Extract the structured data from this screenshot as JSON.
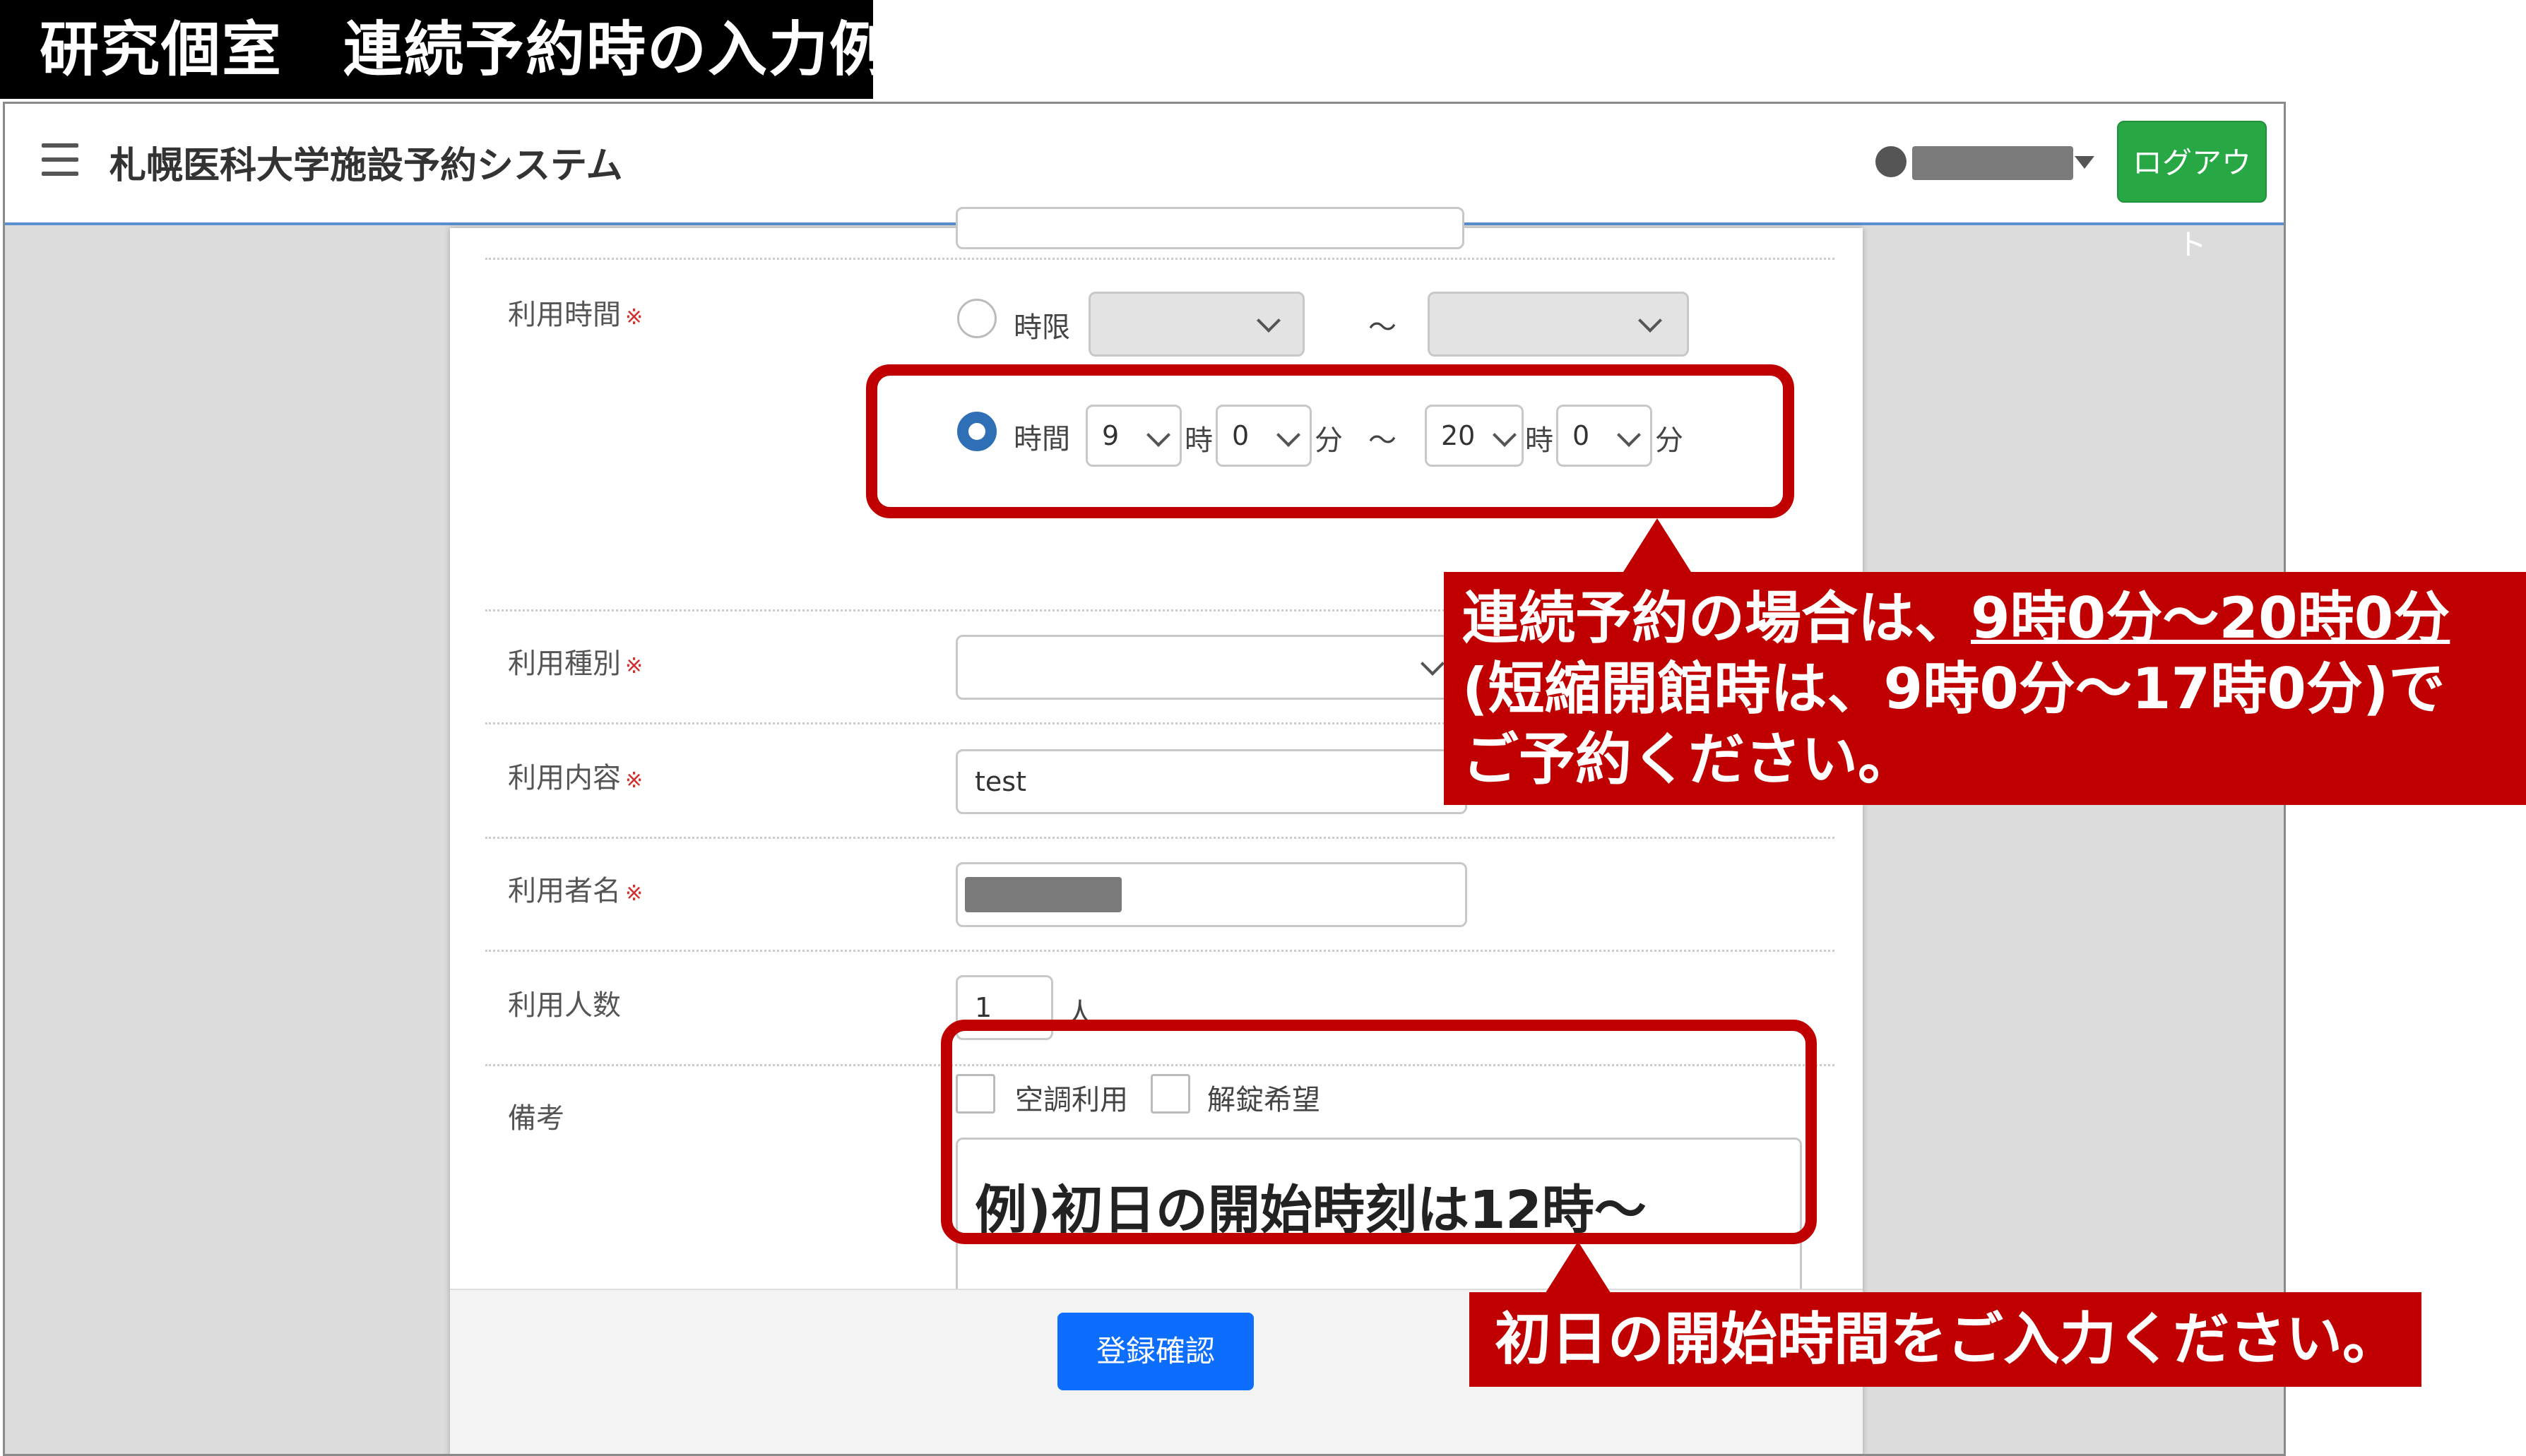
{
  "header_label": "研究個室　連続予約時の入力例",
  "navbar": {
    "app_title": "札幌医科大学施設予約システム",
    "logout_label": "ログアウト"
  },
  "form": {
    "required_mark": "※",
    "time": {
      "label": "利用時間",
      "period_option": "時限",
      "tilde": "～",
      "time_option": "時間",
      "start_hour": "9",
      "start_minute": "0",
      "end_hour": "20",
      "end_minute": "0",
      "hour_unit": "時",
      "minute_unit": "分"
    },
    "usage_type": {
      "label": "利用種別",
      "value": ""
    },
    "usage_content": {
      "label": "利用内容",
      "value": "test"
    },
    "user_name": {
      "label": "利用者名"
    },
    "people_count": {
      "label": "利用人数",
      "value": "1",
      "unit": "人"
    },
    "remarks": {
      "label": "備考",
      "checkbox_ac": "空調利用",
      "checkbox_unlock": "解錠希望",
      "text": "例)初日の開始時刻は12時～"
    },
    "submit_label": "登録確認"
  },
  "annotations": {
    "callout1_line1_prefix": "連続予約の場合は、",
    "callout1_line1_underlined": "9時0分～20時0分",
    "callout1_line2": "(短縮開館時は、9時0分～17時0分)で",
    "callout1_line3": "ご予約ください。",
    "callout2": "初日の開始時間をご入力ください。",
    "color": "#c00000"
  }
}
